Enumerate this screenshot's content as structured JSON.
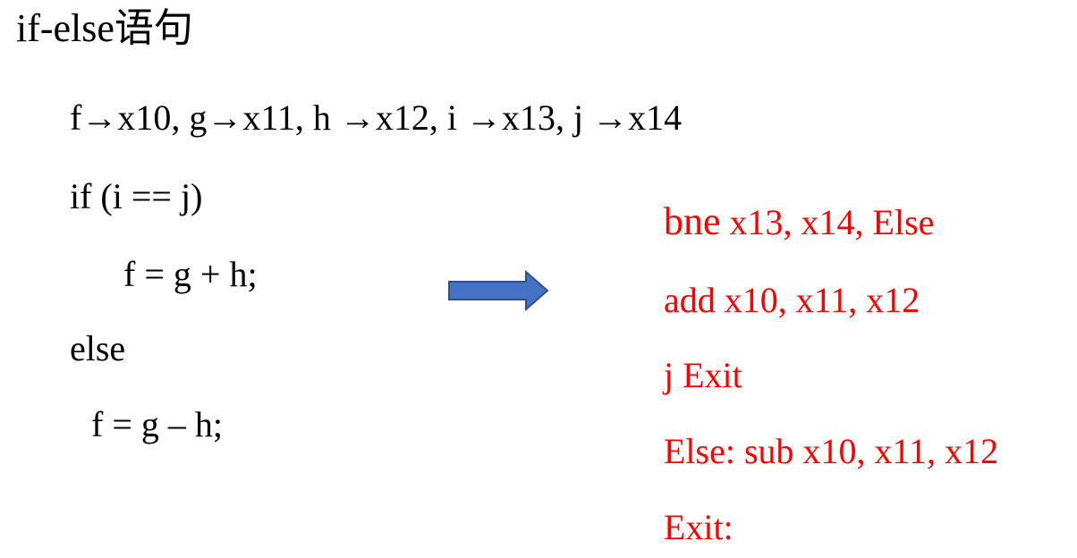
{
  "slide": {
    "title": "if-else语句",
    "mapping": "f→x10, g→x11, h →x12, i →x13, j →x14",
    "c_code": {
      "if_line": "if (i == j)",
      "then_stmt": "f = g + h;",
      "else_line": "else",
      "else_stmt": "f = g – h;"
    },
    "asm_code": {
      "line1_op": "bne",
      "line1_args": " x13, x14, Else",
      "line2": "add x10, x11, x12",
      "line3": "j Exit",
      "line4": "Else:  sub x10, x11, x12",
      "line5": "Exit:"
    },
    "colors": {
      "asm_text": "#ff0000",
      "arrow_fill": "#4472c4",
      "arrow_stroke": "#2f528f"
    },
    "icons": {
      "arrow": "right-arrow-icon"
    }
  }
}
